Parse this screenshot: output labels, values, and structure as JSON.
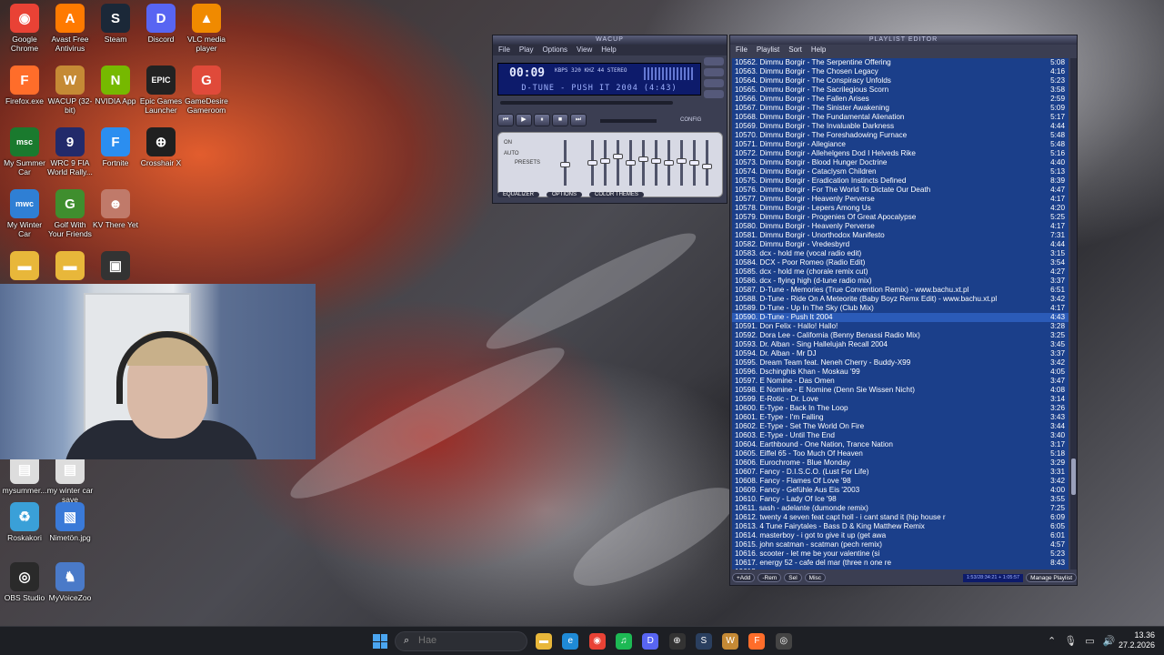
{
  "desktop": {
    "icons": [
      {
        "label": "Google Chrome",
        "glyph": "◉",
        "color": "#e94235"
      },
      {
        "label": "Avast Free Antivirus",
        "glyph": "A",
        "color": "#ff7a00"
      },
      {
        "label": "Steam",
        "glyph": "S",
        "color": "#1b2838"
      },
      {
        "label": "Discord",
        "glyph": "D",
        "color": "#5865f2"
      },
      {
        "label": "VLC media player",
        "glyph": "▲",
        "color": "#f08a00"
      },
      {
        "label": "Firefox.exe",
        "glyph": "F",
        "color": "#ff6d2a"
      },
      {
        "label": "WACUP (32-bit)",
        "glyph": "W",
        "color": "#c58a35"
      },
      {
        "label": "NVIDIA App",
        "glyph": "N",
        "color": "#76b900"
      },
      {
        "label": "Epic Games Launcher",
        "glyph": "EPIC",
        "color": "#222222"
      },
      {
        "label": "GameDesire Gameroom",
        "glyph": "G",
        "color": "#e04a3a"
      },
      {
        "label": "My Summer Car",
        "glyph": "msc",
        "color": "#1a7a2e"
      },
      {
        "label": "WRC 9 FIA World Rally...",
        "glyph": "9",
        "color": "#222a6a"
      },
      {
        "label": "Fortnite",
        "glyph": "F",
        "color": "#2b8ef0"
      },
      {
        "label": "Crosshair X",
        "glyph": "⊕",
        "color": "#202020"
      },
      {
        "label": "My Winter Car",
        "glyph": "mwc",
        "color": "#2f7fd4"
      },
      {
        "label": "Golf With Your Friends",
        "glyph": "G",
        "color": "#3f8e2e"
      },
      {
        "label": "KV There Yet",
        "glyph": "☻",
        "color": "#c07a6a"
      },
      {
        "label": "",
        "glyph": "▣",
        "color": "#333333"
      },
      {
        "label": "",
        "glyph": "▬",
        "color": "#e8b73a"
      },
      {
        "label": "",
        "glyph": "▬",
        "color": "#e8b73a"
      },
      {
        "label": "mysummer...",
        "glyph": "▤",
        "color": "#dddddd"
      },
      {
        "label": "my winter car save",
        "glyph": "▤",
        "color": "#dddddd"
      },
      {
        "label": "Roskakori",
        "glyph": "♻",
        "color": "#3aa0d8"
      },
      {
        "label": "Nimetön.jpg",
        "glyph": "▧",
        "color": "#3a7ad8"
      },
      {
        "label": "OBS Studio",
        "glyph": "◎",
        "color": "#2a2a2a"
      },
      {
        "label": "MyVoiceZoo",
        "glyph": "♞",
        "color": "#4a7ac8"
      }
    ]
  },
  "winamp": {
    "title": "WACUP",
    "menu": [
      "File",
      "Play",
      "Options",
      "View",
      "Help"
    ],
    "time": "00:09",
    "badges": "KBPS 320 KHZ 44 STEREO",
    "track": "D-TUNE - PUSH IT 2004 (4:43)",
    "config_label": "CONFIG",
    "eq_tabs": [
      "EQUALIZER",
      "OPTIONS",
      "COLOR THEMES"
    ],
    "eq_presets": "PRESETS",
    "eq_on": "ON",
    "eq_auto": "AUTO",
    "eq_levels": [
      0.55,
      0.5,
      0.45,
      0.35,
      0.5,
      0.4,
      0.45,
      0.5,
      0.45,
      0.5,
      0.6
    ]
  },
  "playlist": {
    "title": "PLAYLIST EDITOR",
    "menu": [
      "File",
      "Playlist",
      "Sort",
      "Help"
    ],
    "current_index": 28,
    "items": [
      {
        "t": "10562. Dimmu Borgir - The Serpentine Offering",
        "d": "5:08"
      },
      {
        "t": "10563. Dimmu Borgir - The Chosen Legacy",
        "d": "4:16"
      },
      {
        "t": "10564. Dimmu Borgir - The Conspiracy Unfolds",
        "d": "5:23"
      },
      {
        "t": "10565. Dimmu Borgir - The Sacrilegious Scorn",
        "d": "3:58"
      },
      {
        "t": "10566. Dimmu Borgir - The Fallen Arises",
        "d": "2:59"
      },
      {
        "t": "10567. Dimmu Borgir - The Sinister Awakening",
        "d": "5:09"
      },
      {
        "t": "10568. Dimmu Borgir - The Fundamental Alienation",
        "d": "5:17"
      },
      {
        "t": "10569. Dimmu Borgir - The Invaluable Darkness",
        "d": "4:44"
      },
      {
        "t": "10570. Dimmu Borgir - The Foreshadowing Furnace",
        "d": "5:48"
      },
      {
        "t": "10571. Dimmu Borgir - Allegiance",
        "d": "5:48"
      },
      {
        "t": "10572. Dimmu Borgir - Allehelgens Dod I Helveds Rike",
        "d": "5:16"
      },
      {
        "t": "10573. Dimmu Borgir - Blood Hunger Doctrine",
        "d": "4:40"
      },
      {
        "t": "10574. Dimmu Borgir - Cataclysm Children",
        "d": "5:13"
      },
      {
        "t": "10575. Dimmu Borgir - Eradication Instincts Defined",
        "d": "8:39"
      },
      {
        "t": "10576. Dimmu Borgir - For The World To Dictate Our Death",
        "d": "4:47"
      },
      {
        "t": "10577. Dimmu Borgir - Heavenly Perverse",
        "d": "4:17"
      },
      {
        "t": "10578. Dimmu Borgir - Lepers Among Us",
        "d": "4:20"
      },
      {
        "t": "10579. Dimmu Borgir - Progenies Of Great Apocalypse",
        "d": "5:25"
      },
      {
        "t": "10580. Dimmu Borgir - Heavenly Perverse",
        "d": "4:17"
      },
      {
        "t": "10581. Dimmu Borgir - Unorthodox Manifesto",
        "d": "7:31"
      },
      {
        "t": "10582. Dimmu Borgir - Vredesbyrd",
        "d": "4:44"
      },
      {
        "t": "10583. dcx - hold me (vocal radio edit)",
        "d": "3:15"
      },
      {
        "t": "10584. DCX - Poor Romeo (Radio Edit)",
        "d": "3:54"
      },
      {
        "t": "10585. dcx - hold me (chorale remix cut)",
        "d": "4:27"
      },
      {
        "t": "10586. dcx - flying high (d-tune radio mix)",
        "d": "3:37"
      },
      {
        "t": "10587. D-Tune - Memories (True Convention Remix) - www.bachu.xt.pl",
        "d": "6:51"
      },
      {
        "t": "10588. D-Tune - Ride On A Meteorite (Baby Boyz Remx Edit) - www.bachu.xt.pl",
        "d": "3:42"
      },
      {
        "t": "10589. D-Tune - Up In The Sky (Club Mix)",
        "d": "4:17"
      },
      {
        "t": "10590. D-Tune - Push It 2004",
        "d": "4:43"
      },
      {
        "t": "10591. Don Felix - Hallo! Hallo!",
        "d": "3:28"
      },
      {
        "t": "10592. Dora Lee - California (Benny Benassi Radio Mix)",
        "d": "3:25"
      },
      {
        "t": "10593. Dr. Alban - Sing Hallelujah Recall 2004",
        "d": "3:45"
      },
      {
        "t": "10594. Dr. Alban - Mr DJ",
        "d": "3:37"
      },
      {
        "t": "10595. Dream Team feat. Neneh Cherry - Buddy-X99",
        "d": "3:42"
      },
      {
        "t": "10596. Dschinghis Khan - Moskau '99",
        "d": "4:05"
      },
      {
        "t": "10597. E Nomine - Das Omen",
        "d": "3:47"
      },
      {
        "t": "10598. E Nomine - E Nomine (Denn Sie Wissen Nicht)",
        "d": "4:08"
      },
      {
        "t": "10599. E-Rotic - Dr. Love",
        "d": "3:14"
      },
      {
        "t": "10600. E-Type - Back In The Loop",
        "d": "3:26"
      },
      {
        "t": "10601. E-Type - I'm Falling",
        "d": "3:43"
      },
      {
        "t": "10602. E-Type - Set The World On Fire",
        "d": "3:44"
      },
      {
        "t": "10603. E-Type - Until The End",
        "d": "3:40"
      },
      {
        "t": "10604. Earthbound - One Nation, Trance Nation",
        "d": "3:17"
      },
      {
        "t": "10605. Eiffel 65 - Too Much Of Heaven",
        "d": "5:18"
      },
      {
        "t": "10606. Eurochrome - Blue Monday",
        "d": "3:29"
      },
      {
        "t": "10607. Fancy - D.I.S.C.O. (Lust For Life)",
        "d": "3:31"
      },
      {
        "t": "10608. Fancy - Flames Of Love '98",
        "d": "3:42"
      },
      {
        "t": "10609. Fancy - Gefühle Aus Eis '2003",
        "d": "4:00"
      },
      {
        "t": "10610. Fancy - Lady Of Ice '98",
        "d": "3:55"
      },
      {
        "t": "10611. sash - adelante (dumonde remix)",
        "d": "7:25"
      },
      {
        "t": "10612. twenty 4 seven feat capt holl - i cant stand it (hip house r",
        "d": "6:09"
      },
      {
        "t": "10613. 4 Tune Fairytales - Bass D & King Matthew Remix",
        "d": "6:05"
      },
      {
        "t": "10614. masterboy - i got to give it up (get awa",
        "d": "6:01"
      },
      {
        "t": "10615. john scatman - scatman (pech remix)",
        "d": "4:57"
      },
      {
        "t": "10616. scooter - let me be your valentine (si",
        "d": "5:23"
      },
      {
        "t": "10617. energy 52 - cafe del mar (three n one re",
        "d": "8:43"
      },
      {
        "t": "10618. ...",
        "d": ""
      }
    ],
    "bottom_buttons": [
      "+Add",
      "-Rem",
      "Sel",
      "Misc"
    ],
    "info": "1:53/28:34:21 + 1:05:57",
    "manage": "Manage Playlist"
  },
  "taskbar": {
    "search_placeholder": "Hae",
    "apps": [
      {
        "name": "file-explorer",
        "glyph": "▬",
        "color": "#e8b73a"
      },
      {
        "name": "edge",
        "glyph": "e",
        "color": "#1f8ad6"
      },
      {
        "name": "chrome",
        "glyph": "◉",
        "color": "#e94235"
      },
      {
        "name": "spotify",
        "glyph": "♫",
        "color": "#1db954"
      },
      {
        "name": "discord",
        "glyph": "D",
        "color": "#5865f2"
      },
      {
        "name": "crosshair",
        "glyph": "⊕",
        "color": "#333333"
      },
      {
        "name": "steam",
        "glyph": "S",
        "color": "#2a3f5f"
      },
      {
        "name": "wacup",
        "glyph": "W",
        "color": "#c58a35"
      },
      {
        "name": "firefox",
        "glyph": "F",
        "color": "#ff6d2a"
      },
      {
        "name": "obs",
        "glyph": "◎",
        "color": "#444444"
      }
    ],
    "time": "13.36",
    "date": "27.2.2026"
  }
}
